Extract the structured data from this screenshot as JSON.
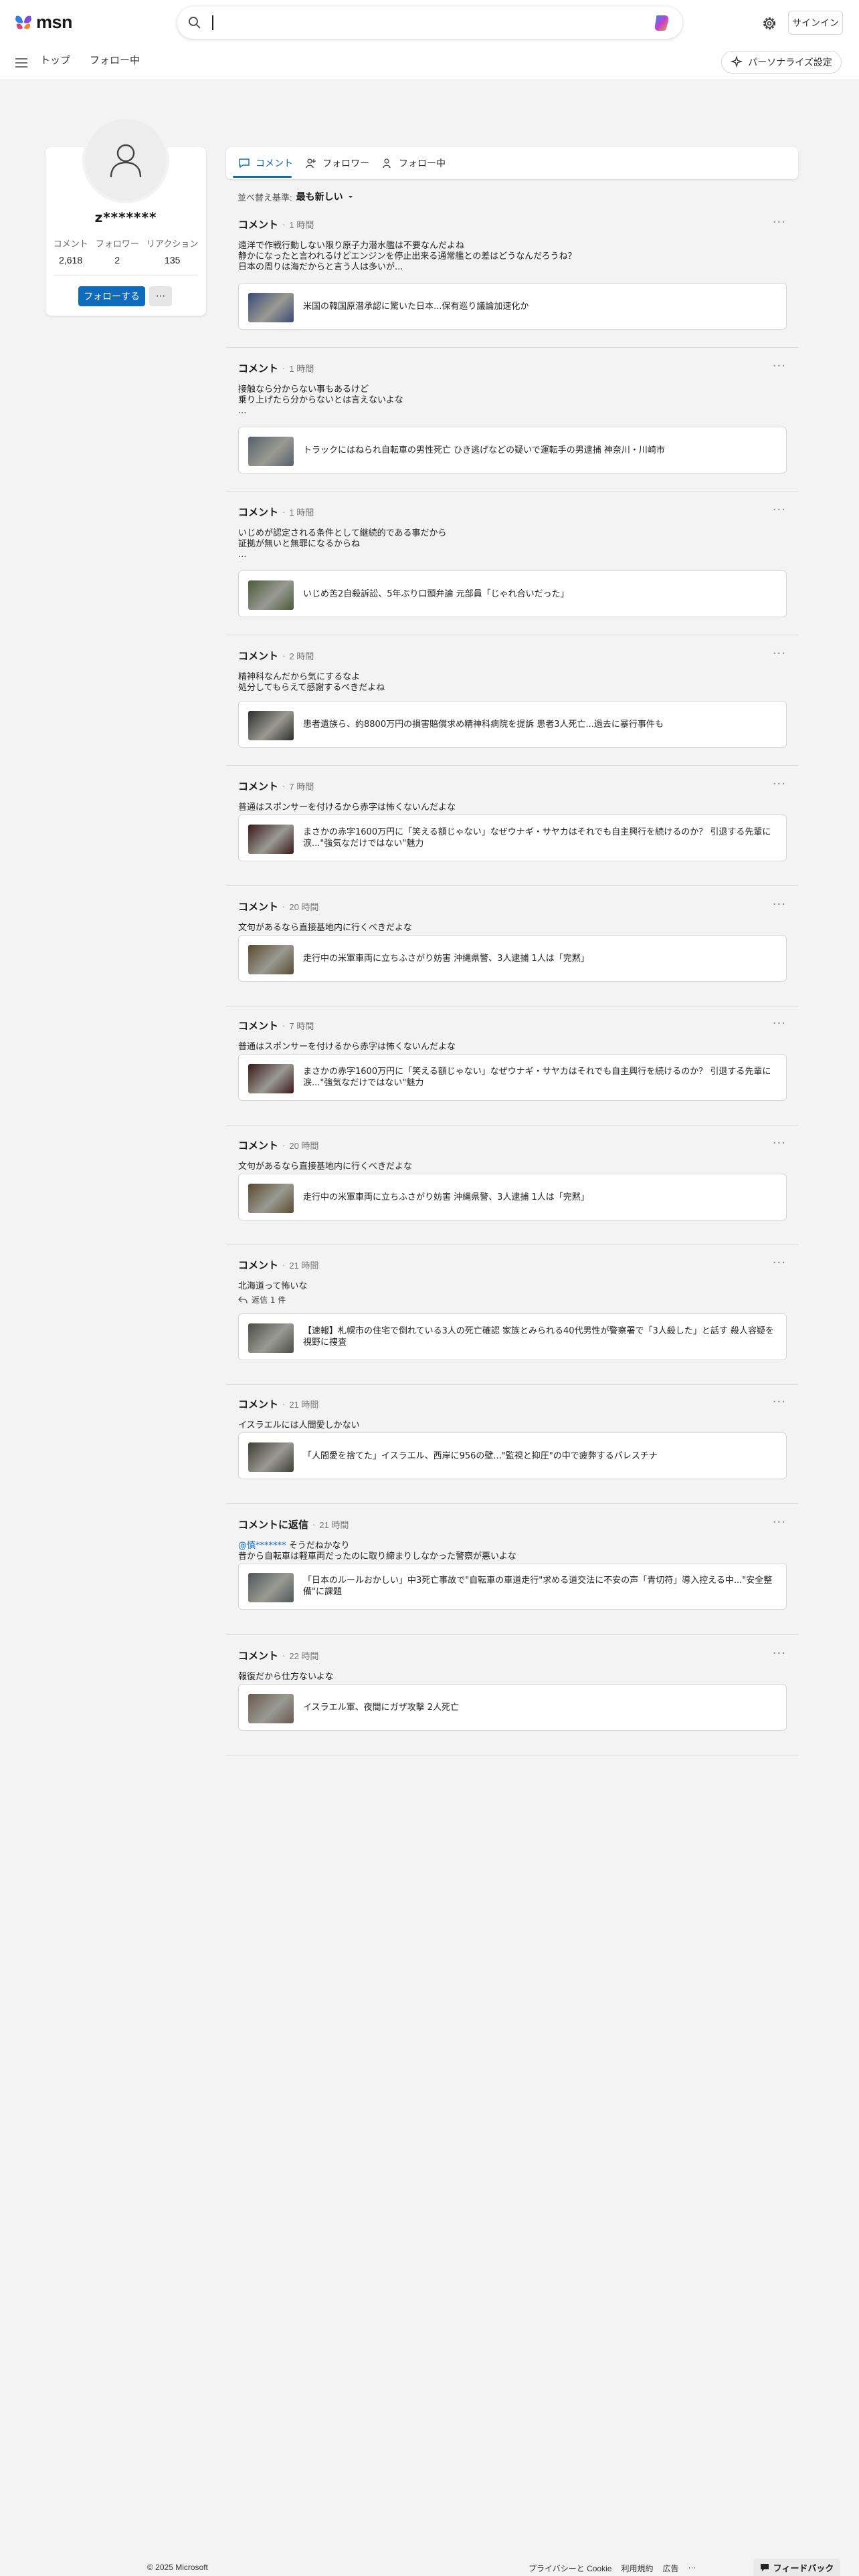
{
  "header": {
    "brand": "msn",
    "search_value": "",
    "signin_label": "サインイン",
    "brand_color": "#0f6cbd"
  },
  "nav": {
    "items": [
      {
        "label": "トップ"
      },
      {
        "label": "フォロー中"
      }
    ],
    "personalize_label": "パーソナライズ設定"
  },
  "profile": {
    "name": "z*******",
    "stats": [
      {
        "label": "コメント",
        "value": "2,618"
      },
      {
        "label": "フォロワー",
        "value": "2"
      },
      {
        "label": "リアクション",
        "value": "135"
      }
    ],
    "follow_label": "フォローする",
    "more_label": "···"
  },
  "tabs": [
    {
      "label": "コメント",
      "icon": "comment-icon",
      "active": true
    },
    {
      "label": "フォロワー",
      "icon": "followers-icon",
      "active": false
    },
    {
      "label": "フォロー中",
      "icon": "following-icon",
      "active": false
    }
  ],
  "sort": {
    "label": "並べ替え基準:",
    "value": "最も新しい"
  },
  "comments": [
    {
      "type": "コメント",
      "time": "1 時間",
      "lines": [
        "遠洋で作戦行動しない限り原子力潜水艦は不要なんだよね",
        "静かになったと言われるけどエンジンを停止出来る通常艦との差はどうなんだろうね？",
        "日本の周りは海だからと言う人は多いが..."
      ],
      "article": "米国の韓国原潜承認に驚いた日本...保有巡り議論加速化か",
      "thumb": "#3a4a7a"
    },
    {
      "type": "コメント",
      "time": "1 時間",
      "lines": [
        "接触なら分からない事もあるけど",
        "乗り上げたら分からないとは言えないよな",
        "..."
      ],
      "article": "トラックにはねられ自転車の男性死亡 ひき逃げなどの疑いで運転手の男逮捕 神奈川・川崎市",
      "thumb": "#55606a"
    },
    {
      "type": "コメント",
      "time": "1 時間",
      "lines": [
        "いじめが認定される条件として継続的である事だから",
        "証拠が無いと無罪になるからね",
        "..."
      ],
      "article": "いじめ苦2自殺訴訟、5年ぶり口頭弁論 元部員「じゃれ合いだった」",
      "thumb": "#4a5a3a"
    },
    {
      "type": "コメント",
      "time": "2 時間",
      "lines": [
        "精神科なんだから気にするなよ",
        "処分してもらえて感謝するべきだよね"
      ],
      "article": "患者遺族ら、約8800万円の損害賠償求め精神科病院を提訴 患者3人死亡...過去に暴行事件も",
      "thumb": "#2d2d2d"
    },
    {
      "type": "コメント",
      "time": "7 時間",
      "lines": [
        "普通はスポンサーを付けるから赤字は怖くないんだよな"
      ],
      "article": "まさかの赤字1600万円に「笑える額じゃない」なぜウナギ・サヤカはそれでも自主興行を続けるのか？ 引退する先輩に涙...\"強気なだけではない\"魅力",
      "thumb": "#3a1818"
    },
    {
      "type": "コメント",
      "time": "20 時間",
      "lines": [
        "文句があるなら直接基地内に行くべきだよな"
      ],
      "article": "走行中の米軍車両に立ちふさがり妨害 沖縄県警、3人逮捕 1人は「完黙」",
      "thumb": "#5a4a30"
    },
    {
      "type": "コメント",
      "time": "7 時間",
      "lines": [
        "普通はスポンサーを付けるから赤字は怖くないんだよな"
      ],
      "article": "まさかの赤字1600万円に「笑える額じゃない」なぜウナギ・サヤカはそれでも自主興行を続けるのか？ 引退する先輩に涙...\"強気なだけではない\"魅力",
      "thumb": "#3a1818"
    },
    {
      "type": "コメント",
      "time": "20 時間",
      "lines": [
        "文句があるなら直接基地内に行くべきだよな"
      ],
      "article": "走行中の米軍車両に立ちふさがり妨害 沖縄県警、3人逮捕 1人は「完黙」",
      "thumb": "#5a4a30"
    },
    {
      "type": "コメント",
      "time": "21 時間",
      "lines": [
        "北海道って怖いな"
      ],
      "reply_count": "返信 1 件",
      "article": "【速報】札幌市の住宅で倒れている3人の死亡確認 家族とみられる40代男性が警察署で「3人殺した」と話す 殺人容疑を視野に捜査",
      "thumb": "#4a4e46"
    },
    {
      "type": "コメント",
      "time": "21 時間",
      "lines": [
        "イスラエルには人間愛しかない"
      ],
      "article": "「人間愛を捨てた」イスラエル、西岸に956の壁...\"監視と抑圧\"の中で疲弊するパレスチナ",
      "thumb": "#3e3e36"
    },
    {
      "type": "コメントに返信",
      "time": "21 時間",
      "mention": "@慎*******",
      "lines": [
        "そうだねかなり",
        "昔から自転車は軽車両だったのに取り締まりしなかった警察が悪いよな"
      ],
      "article": "「日本のルールおかしい」中3死亡事故で\"自転車の車道走行\"求める道交法に不安の声「青切符」導入控える中...\"安全整備\"に課題",
      "thumb": "#50565a"
    },
    {
      "type": "コメント",
      "time": "22 時間",
      "lines": [
        "報復だから仕方ないよな"
      ],
      "article": "イスラエル軍、夜間にガザ攻撃 2人死亡",
      "thumb": "#6a5a4e"
    }
  ],
  "footer": {
    "copyright": "© 2025 Microsoft",
    "links": [
      "プライバシーと Cookie",
      "利用規約",
      "広告",
      "···"
    ],
    "feedback_label": "フィードバック"
  }
}
